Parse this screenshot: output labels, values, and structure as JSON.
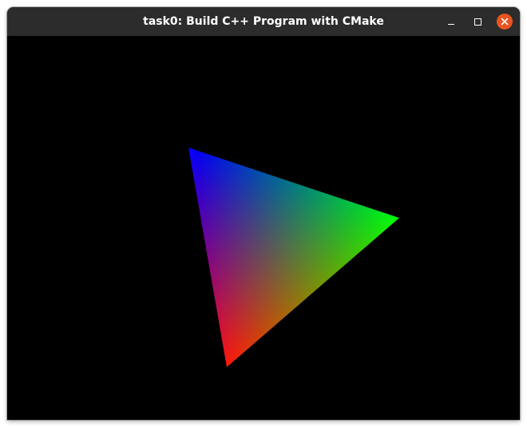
{
  "window": {
    "title": "task0: Build C++ Program with CMake"
  },
  "controls": {
    "minimize": "minimize",
    "maximize": "maximize",
    "close": "close"
  },
  "scene": {
    "background_color": "#000000",
    "primitive": "triangle",
    "vertex_colors": [
      "#ff0000",
      "#00ff00",
      "#0000ff"
    ]
  }
}
